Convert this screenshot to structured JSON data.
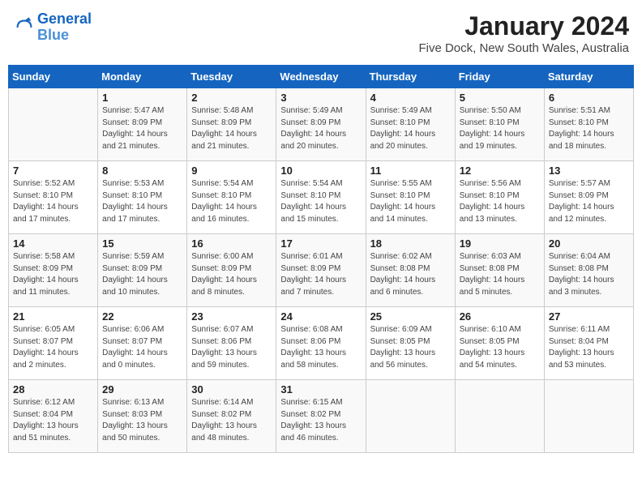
{
  "header": {
    "logo_line1": "General",
    "logo_line2": "Blue",
    "title": "January 2024",
    "subtitle": "Five Dock, New South Wales, Australia"
  },
  "days_of_week": [
    "Sunday",
    "Monday",
    "Tuesday",
    "Wednesday",
    "Thursday",
    "Friday",
    "Saturday"
  ],
  "weeks": [
    [
      {
        "day": "",
        "detail": ""
      },
      {
        "day": "1",
        "detail": "Sunrise: 5:47 AM\nSunset: 8:09 PM\nDaylight: 14 hours\nand 21 minutes."
      },
      {
        "day": "2",
        "detail": "Sunrise: 5:48 AM\nSunset: 8:09 PM\nDaylight: 14 hours\nand 21 minutes."
      },
      {
        "day": "3",
        "detail": "Sunrise: 5:49 AM\nSunset: 8:09 PM\nDaylight: 14 hours\nand 20 minutes."
      },
      {
        "day": "4",
        "detail": "Sunrise: 5:49 AM\nSunset: 8:10 PM\nDaylight: 14 hours\nand 20 minutes."
      },
      {
        "day": "5",
        "detail": "Sunrise: 5:50 AM\nSunset: 8:10 PM\nDaylight: 14 hours\nand 19 minutes."
      },
      {
        "day": "6",
        "detail": "Sunrise: 5:51 AM\nSunset: 8:10 PM\nDaylight: 14 hours\nand 18 minutes."
      }
    ],
    [
      {
        "day": "7",
        "detail": "Sunrise: 5:52 AM\nSunset: 8:10 PM\nDaylight: 14 hours\nand 17 minutes."
      },
      {
        "day": "8",
        "detail": "Sunrise: 5:53 AM\nSunset: 8:10 PM\nDaylight: 14 hours\nand 17 minutes."
      },
      {
        "day": "9",
        "detail": "Sunrise: 5:54 AM\nSunset: 8:10 PM\nDaylight: 14 hours\nand 16 minutes."
      },
      {
        "day": "10",
        "detail": "Sunrise: 5:54 AM\nSunset: 8:10 PM\nDaylight: 14 hours\nand 15 minutes."
      },
      {
        "day": "11",
        "detail": "Sunrise: 5:55 AM\nSunset: 8:10 PM\nDaylight: 14 hours\nand 14 minutes."
      },
      {
        "day": "12",
        "detail": "Sunrise: 5:56 AM\nSunset: 8:10 PM\nDaylight: 14 hours\nand 13 minutes."
      },
      {
        "day": "13",
        "detail": "Sunrise: 5:57 AM\nSunset: 8:09 PM\nDaylight: 14 hours\nand 12 minutes."
      }
    ],
    [
      {
        "day": "14",
        "detail": "Sunrise: 5:58 AM\nSunset: 8:09 PM\nDaylight: 14 hours\nand 11 minutes."
      },
      {
        "day": "15",
        "detail": "Sunrise: 5:59 AM\nSunset: 8:09 PM\nDaylight: 14 hours\nand 10 minutes."
      },
      {
        "day": "16",
        "detail": "Sunrise: 6:00 AM\nSunset: 8:09 PM\nDaylight: 14 hours\nand 8 minutes."
      },
      {
        "day": "17",
        "detail": "Sunrise: 6:01 AM\nSunset: 8:09 PM\nDaylight: 14 hours\nand 7 minutes."
      },
      {
        "day": "18",
        "detail": "Sunrise: 6:02 AM\nSunset: 8:08 PM\nDaylight: 14 hours\nand 6 minutes."
      },
      {
        "day": "19",
        "detail": "Sunrise: 6:03 AM\nSunset: 8:08 PM\nDaylight: 14 hours\nand 5 minutes."
      },
      {
        "day": "20",
        "detail": "Sunrise: 6:04 AM\nSunset: 8:08 PM\nDaylight: 14 hours\nand 3 minutes."
      }
    ],
    [
      {
        "day": "21",
        "detail": "Sunrise: 6:05 AM\nSunset: 8:07 PM\nDaylight: 14 hours\nand 2 minutes."
      },
      {
        "day": "22",
        "detail": "Sunrise: 6:06 AM\nSunset: 8:07 PM\nDaylight: 14 hours\nand 0 minutes."
      },
      {
        "day": "23",
        "detail": "Sunrise: 6:07 AM\nSunset: 8:06 PM\nDaylight: 13 hours\nand 59 minutes."
      },
      {
        "day": "24",
        "detail": "Sunrise: 6:08 AM\nSunset: 8:06 PM\nDaylight: 13 hours\nand 58 minutes."
      },
      {
        "day": "25",
        "detail": "Sunrise: 6:09 AM\nSunset: 8:05 PM\nDaylight: 13 hours\nand 56 minutes."
      },
      {
        "day": "26",
        "detail": "Sunrise: 6:10 AM\nSunset: 8:05 PM\nDaylight: 13 hours\nand 54 minutes."
      },
      {
        "day": "27",
        "detail": "Sunrise: 6:11 AM\nSunset: 8:04 PM\nDaylight: 13 hours\nand 53 minutes."
      }
    ],
    [
      {
        "day": "28",
        "detail": "Sunrise: 6:12 AM\nSunset: 8:04 PM\nDaylight: 13 hours\nand 51 minutes."
      },
      {
        "day": "29",
        "detail": "Sunrise: 6:13 AM\nSunset: 8:03 PM\nDaylight: 13 hours\nand 50 minutes."
      },
      {
        "day": "30",
        "detail": "Sunrise: 6:14 AM\nSunset: 8:02 PM\nDaylight: 13 hours\nand 48 minutes."
      },
      {
        "day": "31",
        "detail": "Sunrise: 6:15 AM\nSunset: 8:02 PM\nDaylight: 13 hours\nand 46 minutes."
      },
      {
        "day": "",
        "detail": ""
      },
      {
        "day": "",
        "detail": ""
      },
      {
        "day": "",
        "detail": ""
      }
    ]
  ]
}
